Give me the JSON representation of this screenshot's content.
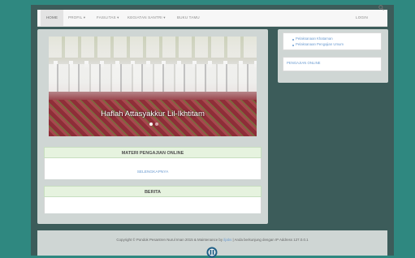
{
  "navbar": {
    "items": [
      {
        "label": "HOME"
      },
      {
        "label": "PROFIL ▾"
      },
      {
        "label": "FASILITAS ▾"
      },
      {
        "label": "KEGIATAN SANTRI ▾"
      },
      {
        "label": "BUKU TAMU"
      }
    ],
    "login_label": "LOGIN",
    "search_icon": "search-icon"
  },
  "slider": {
    "caption": "Haflah Attasyakkur Lil-Ikhtitam",
    "active_slide": 1,
    "slide_count": 2
  },
  "materi": {
    "title": "MATERI PENGAJIAN ONLINE",
    "link": "SELENGKAPNYA"
  },
  "berita": {
    "title": "BERITA"
  },
  "sidebar": {
    "links": [
      "Pelaksanaan Khataman",
      "Pelaksanaan Pengajian Umum"
    ],
    "pengajian_label": "PENGAJIAN ONLINE"
  },
  "footer": {
    "copyright": "Copyright © Pondok Pesantren Nurul Iman 2015 & Maintenance by",
    "maintainer": "iljabs",
    "visitor_text": "| Anda berkunjung dengan IP Address 127.0.0.1"
  },
  "colors": {
    "background": "#2f8880",
    "panel": "#cfd6d4",
    "header_green": "#e6f3df",
    "link": "#6a9ad0"
  }
}
